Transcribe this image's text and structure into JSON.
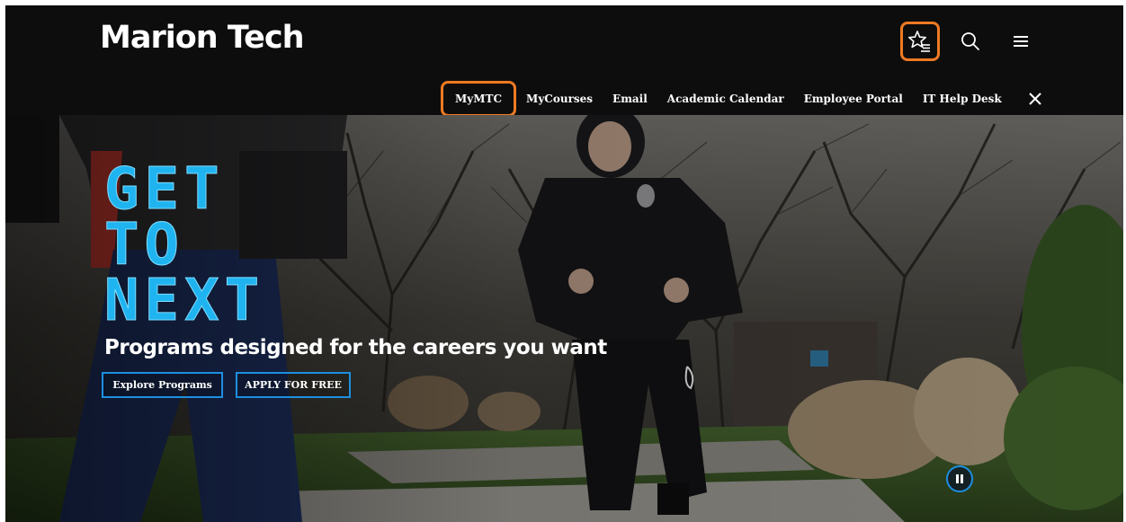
{
  "header": {
    "logo_text": "Marion Tech",
    "icons": [
      "favorites-icon",
      "search-icon",
      "menu-icon"
    ]
  },
  "quicklinks": {
    "items": [
      {
        "label": "MyMTC"
      },
      {
        "label": "MyCourses"
      },
      {
        "label": "Email"
      },
      {
        "label": "Academic Calendar"
      },
      {
        "label": "Employee Portal"
      },
      {
        "label": "IT Help Desk"
      }
    ],
    "close_icon": "close-icon"
  },
  "hero": {
    "headline": [
      "GET",
      "TO",
      "NEXT"
    ],
    "tagline": "Programs designed for the careers you want",
    "buttons": {
      "explore": "Explore Programs",
      "apply": "APPLY FOR FREE"
    },
    "pause_icon": "pause-icon"
  },
  "colors": {
    "header_bg": "#0d0d0d",
    "highlight": "#ee7a22",
    "accent_blue": "#1fb4f0",
    "button_border": "#1d8fe0"
  }
}
